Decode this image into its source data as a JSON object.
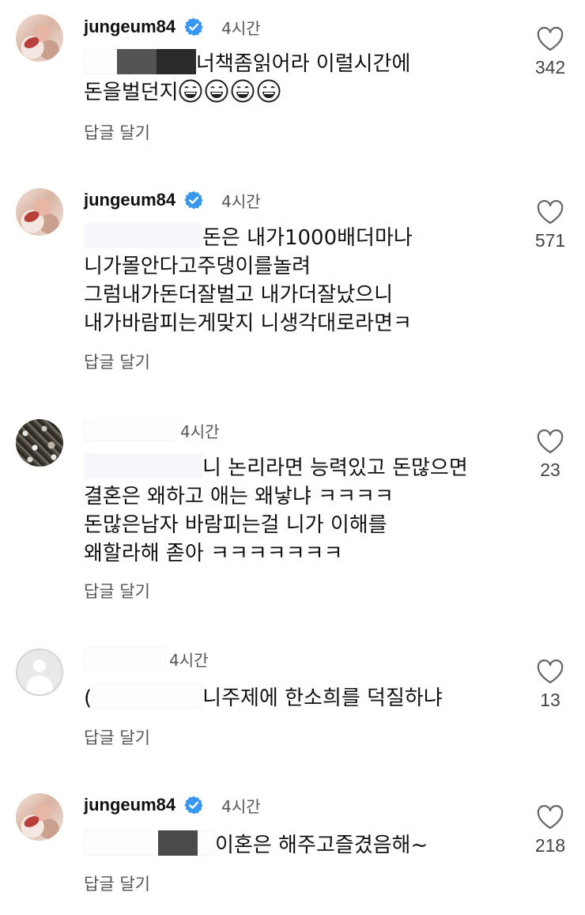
{
  "comments": [
    {
      "username": "jungeum84",
      "verified": true,
      "time": "4시간",
      "lines": [
        "너책좀읽어라 이럴시간에",
        "돈을벌던지"
      ],
      "emoji": [
        "grinning-sweat-emoji",
        "grinning-sweat-emoji",
        "grinning-sweat-emoji",
        "grinning-sweat-emoji"
      ],
      "reply_label": "답글 달기",
      "likes": "342"
    },
    {
      "username": "jungeum84",
      "verified": true,
      "time": "4시간",
      "lines": [
        "돈은 내가1000배더마나",
        "니가몰안다고주댕이를놀려",
        "그럼내가돈더잘벌고 내가더잘났으니",
        "내가바람피는게맞지 니생각대로라면ㅋ"
      ],
      "reply_label": "답글 달기",
      "likes": "571"
    },
    {
      "username": "",
      "time": "4시간",
      "lines": [
        "니 논리라면 능력있고 돈많으면",
        "결혼은 왜하고 애는 왜낳냐  ㅋㅋㅋㅋ",
        "돈많은남자 바람피는걸 니가 이해를",
        "왜할라해 졷아 ㅋㅋㅋㅋㅋㅋㅋ"
      ],
      "reply_label": "답글 달기",
      "likes": "23"
    },
    {
      "username": "",
      "time": "4시간",
      "lines": [
        "(",
        "니주제에 한소희를 덕질하냐"
      ],
      "reply_label": "답글 달기",
      "likes": "13"
    },
    {
      "username": "jungeum84",
      "verified": true,
      "time": "4시간",
      "lines": [
        "이혼은 해주고즐겼음해~"
      ],
      "reply_label": "답글 달기",
      "likes": "218"
    }
  ],
  "colors": {
    "verified_badge": "#3897f0",
    "text": "#111111",
    "secondary_text": "#555555",
    "redaction_dark": "#2a2a2a",
    "redaction_gray": "#545454"
  },
  "icons": {
    "like": "heart-outline-icon",
    "verified": "verified-badge-icon"
  }
}
